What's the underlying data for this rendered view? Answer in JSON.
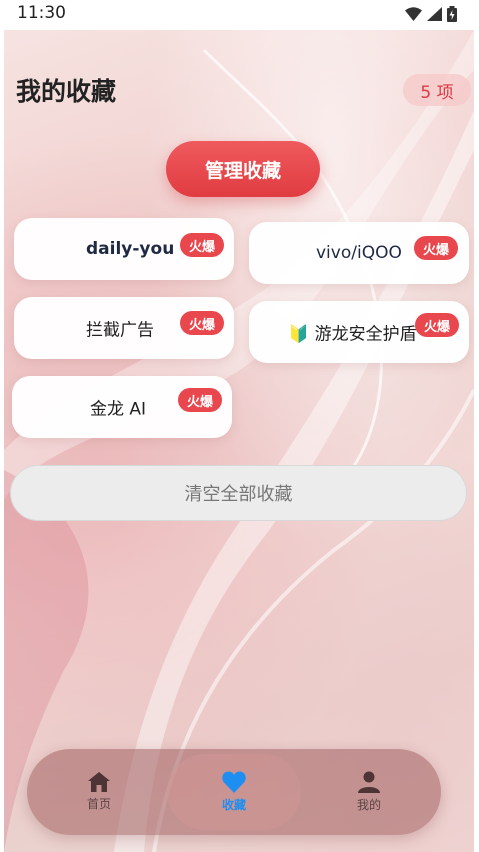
{
  "status_bar": {
    "time": "11:30"
  },
  "header": {
    "title": "我的收藏",
    "count_label": "5 项"
  },
  "manage_label": "管理收藏",
  "hot_label": "火爆",
  "favorites": [
    {
      "label": "daily-you"
    },
    {
      "label": "vivo/iQOO"
    },
    {
      "label": "拦截广告"
    },
    {
      "label": "🔰 游龙安全护盾"
    },
    {
      "label": "金龙 AI"
    }
  ],
  "clear_label": "清空全部收藏",
  "nav": {
    "items": [
      {
        "label": "首页",
        "icon": "home-icon"
      },
      {
        "label": "收藏",
        "icon": "heart-icon",
        "active": true
      },
      {
        "label": "我的",
        "icon": "person-icon"
      }
    ]
  },
  "colors": {
    "accent": "#e8474d",
    "active_nav": "#1e8ff0"
  }
}
